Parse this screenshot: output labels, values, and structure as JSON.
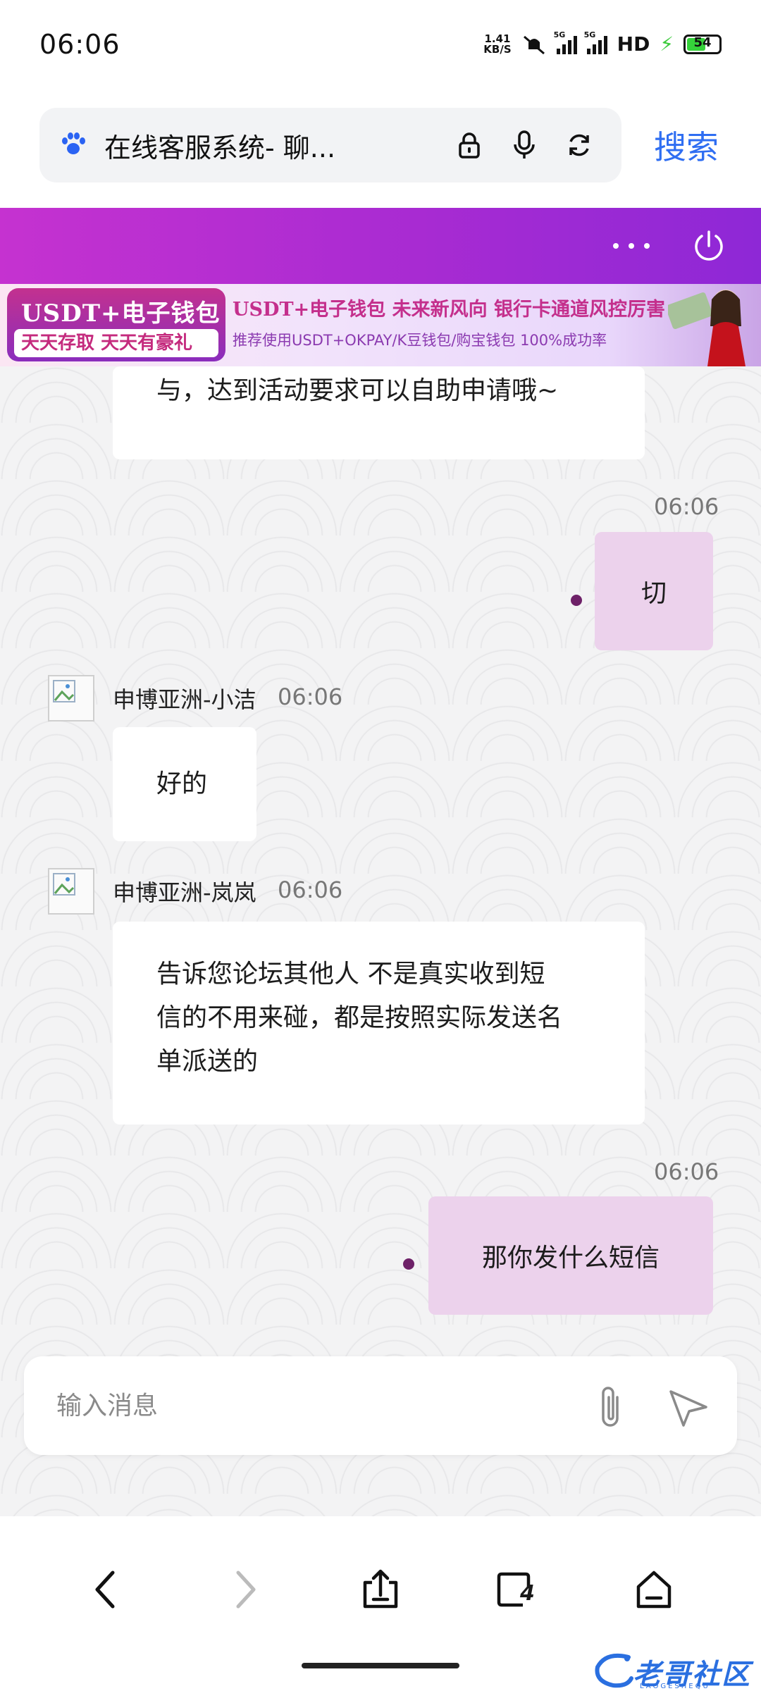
{
  "status_bar": {
    "time": "06:06",
    "net_speed_value": "1.41",
    "net_speed_unit": "KB/S",
    "signal_tag": "5G",
    "hd_label": "HD",
    "battery": "54"
  },
  "browser": {
    "url_title": "在线客服系统- 聊...",
    "search_label": "搜索"
  },
  "banner": {
    "left_title": "USDT+电子钱包",
    "left_sub": "天天存取 天天有豪礼",
    "headline": "USDT+电子钱包   未来新风向   银行卡通道风控厉害",
    "subline": "推荐使用USDT+OKPAY/K豆钱包/购宝钱包   100%成功率"
  },
  "messages": [
    {
      "type": "in",
      "text": "与，达到活动要求可以自助申请哦~"
    },
    {
      "type": "out",
      "time": "06:06",
      "text": "切"
    },
    {
      "type": "in",
      "sender": "申博亚洲-小洁",
      "time": "06:06",
      "text": "好的"
    },
    {
      "type": "in",
      "sender": "申博亚洲-岚岚",
      "time": "06:06",
      "lines": [
        "告诉您论坛其他人 不是真实收到短",
        "信的不用来碰，都是按照实际发送名",
        "单派送的"
      ]
    },
    {
      "type": "out",
      "time": "06:06",
      "text": "那你发什么短信"
    }
  ],
  "input": {
    "placeholder": "输入消息"
  },
  "nav": {
    "tab_count": "4"
  },
  "watermark": {
    "text": "老哥社区",
    "sub": "LAOGESHEQU"
  },
  "colors": {
    "header_gradient_start": "#c532d0",
    "header_gradient_end": "#8e28d6",
    "out_bubble": "#ecd2ec",
    "search_blue": "#2f6ef2"
  }
}
